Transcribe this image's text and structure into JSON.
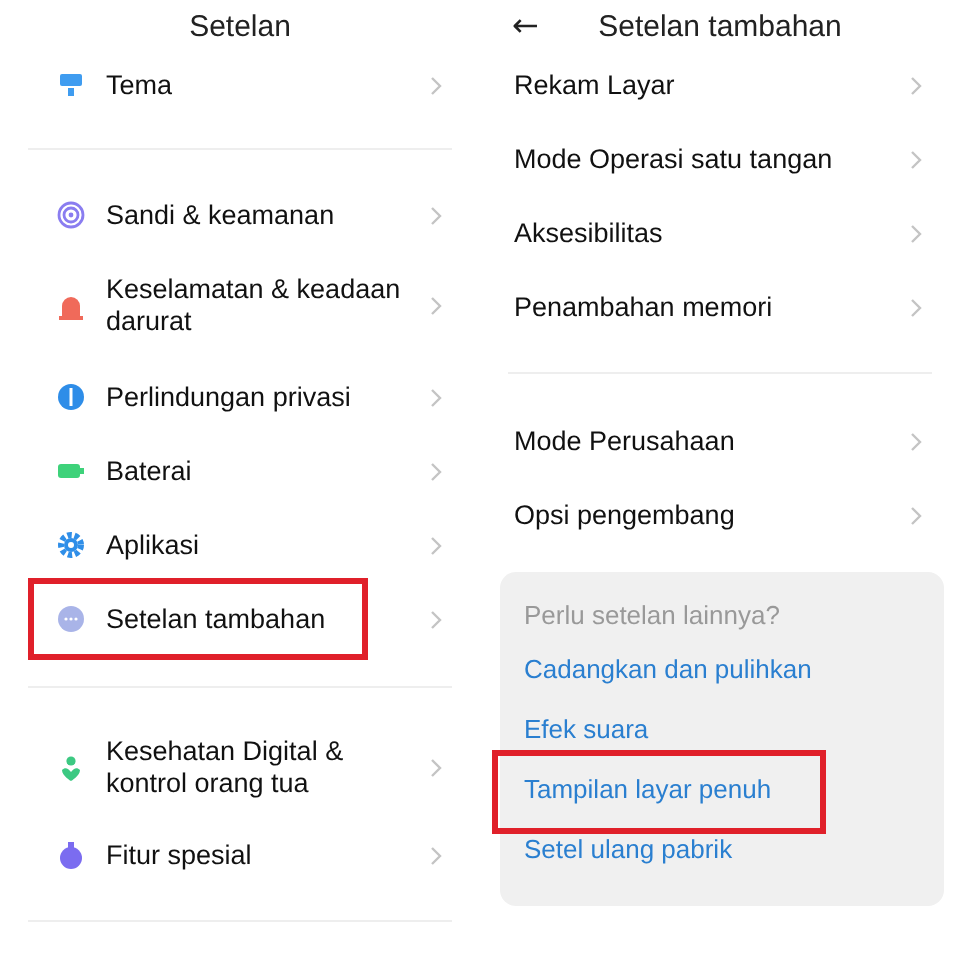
{
  "left_screen": {
    "title": "Setelan",
    "groups": [
      {
        "items": [
          {
            "label": "Tema",
            "color": "#3f9cf0",
            "highlighted": false
          }
        ]
      },
      {
        "items": [
          {
            "label": "Sandi & keamanan",
            "color": "#8a7df0",
            "highlighted": false
          },
          {
            "label": "Keselamatan & keadaan darurat",
            "color": "#f06a5a",
            "highlighted": false
          },
          {
            "label": "Perlindungan privasi",
            "color": "#2e8de8",
            "highlighted": false
          },
          {
            "label": "Baterai",
            "color": "#3ed27a",
            "highlighted": false
          },
          {
            "label": "Aplikasi",
            "color": "#2f8ee8",
            "highlighted": false
          },
          {
            "label": "Setelan tambahan",
            "color": "#a9b4e8",
            "highlighted": true
          }
        ]
      },
      {
        "items": [
          {
            "label": "Kesehatan Digital & kontrol orang tua",
            "color": "#3cc982",
            "highlighted": false
          },
          {
            "label": "Fitur spesial",
            "color": "#7b6cf0",
            "highlighted": false
          }
        ]
      }
    ]
  },
  "right_screen": {
    "back": "←",
    "title": "Setelan tambahan",
    "groups": [
      {
        "items": [
          "Rekam Layar",
          "Mode Operasi satu tangan",
          "Aksesibilitas",
          "Penambahan memori"
        ]
      },
      {
        "items": [
          "Mode Perusahaan",
          "Opsi pengembang"
        ]
      }
    ],
    "suggestions": {
      "heading": "Perlu setelan lainnya?",
      "links": [
        {
          "label": "Cadangkan dan pulihkan",
          "highlighted": false
        },
        {
          "label": "Efek suara",
          "highlighted": false
        },
        {
          "label": "Tampilan layar penuh",
          "highlighted": true
        },
        {
          "label": "Setel ulang pabrik",
          "highlighted": false
        }
      ]
    }
  }
}
